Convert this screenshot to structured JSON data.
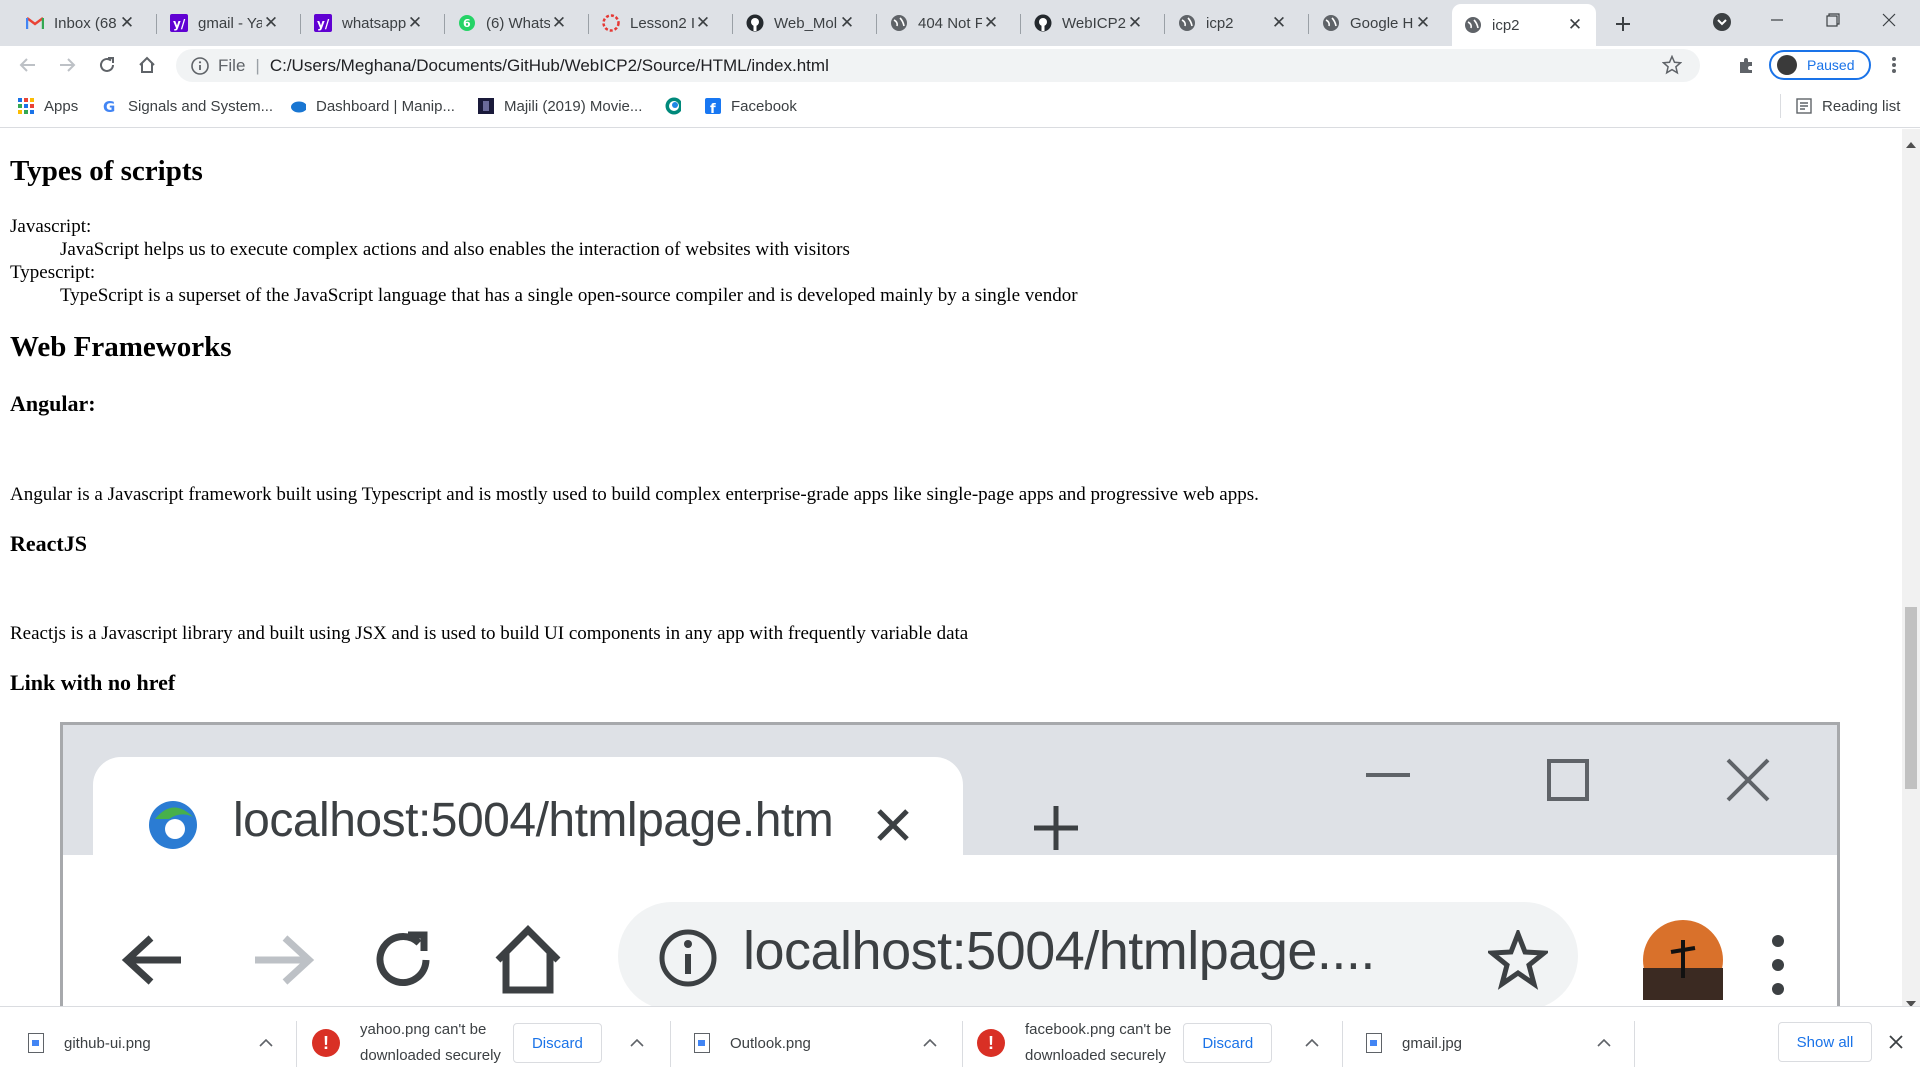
{
  "tabs": [
    {
      "title": "Inbox (68",
      "icon": "gmail-icon"
    },
    {
      "title": "gmail - Ya",
      "icon": "yahoo-icon"
    },
    {
      "title": "whatsapp",
      "icon": "yahoo-icon"
    },
    {
      "title": "(6) Whats",
      "icon": "whatsapp-icon"
    },
    {
      "title": "Lesson2 I",
      "icon": "lesson-icon"
    },
    {
      "title": "Web_Mol",
      "icon": "github-icon"
    },
    {
      "title": "404 Not F",
      "icon": "globe-icon"
    },
    {
      "title": "WebICP2",
      "icon": "github-icon"
    },
    {
      "title": "icp2",
      "icon": "globe-icon"
    },
    {
      "title": "Google H",
      "icon": "globe-icon"
    },
    {
      "title": "icp2",
      "icon": "globe-icon"
    }
  ],
  "toolbar": {
    "scheme": "File",
    "url": "C:/Users/Meghana/Documents/GitHub/WebICP2/Source/HTML/index.html",
    "profile_label": "Paused"
  },
  "bookmarks": {
    "items": [
      {
        "label": "Apps",
        "icon": "apps-grid-icon"
      },
      {
        "label": "Signals and System...",
        "icon": "google-icon"
      },
      {
        "label": "Dashboard | Manip...",
        "icon": "cloud-icon"
      },
      {
        "label": "Majili (2019) Movie...",
        "icon": "movie-icon"
      },
      {
        "label": "",
        "icon": "circle-logo-icon"
      },
      {
        "label": "Facebook",
        "icon": "facebook-icon"
      }
    ],
    "reading_list": "Reading list"
  },
  "content": {
    "h_scripts": "Types of scripts",
    "js_term": "Javascript:",
    "js_desc": "JavaScript helps us to execute complex actions and also enables the interaction of websites with visitors",
    "ts_term": "Typescript:",
    "ts_desc": "TypeScript is a superset of the JavaScript language that has a single open-source compiler and is developed mainly by a single vendor",
    "h_frameworks": "Web Frameworks",
    "h_angular": "Angular:",
    "angular_desc": "Angular is a Javascript framework built using Typescript and is mostly used to build complex enterprise-grade apps like single-page apps and progressive web apps.",
    "h_react": "ReactJS",
    "react_desc": "Reactjs is a Javascript library and built using JSX and is used to build UI components in any app with frequently variable data",
    "h_link": "Link with no href"
  },
  "embedded": {
    "tab_title": "localhost:5004/htmlpage.htm",
    "url": "localhost:5004/htmlpage...."
  },
  "downloads": [
    {
      "name": "github-ui.png",
      "type": "file"
    },
    {
      "line1": "yahoo.png can't be",
      "line2": "downloaded securely",
      "type": "warning",
      "action": "Discard"
    },
    {
      "name": "Outlook.png",
      "type": "file"
    },
    {
      "line1": "facebook.png can't be",
      "line2": "downloaded securely",
      "type": "warning",
      "action": "Discard"
    },
    {
      "name": "gmail.jpg",
      "type": "file"
    }
  ],
  "shelf": {
    "show_all": "Show all"
  },
  "colors": {
    "accent": "#1a73e8",
    "warning": "#d93025",
    "tabstrip": "#dee1e6"
  }
}
